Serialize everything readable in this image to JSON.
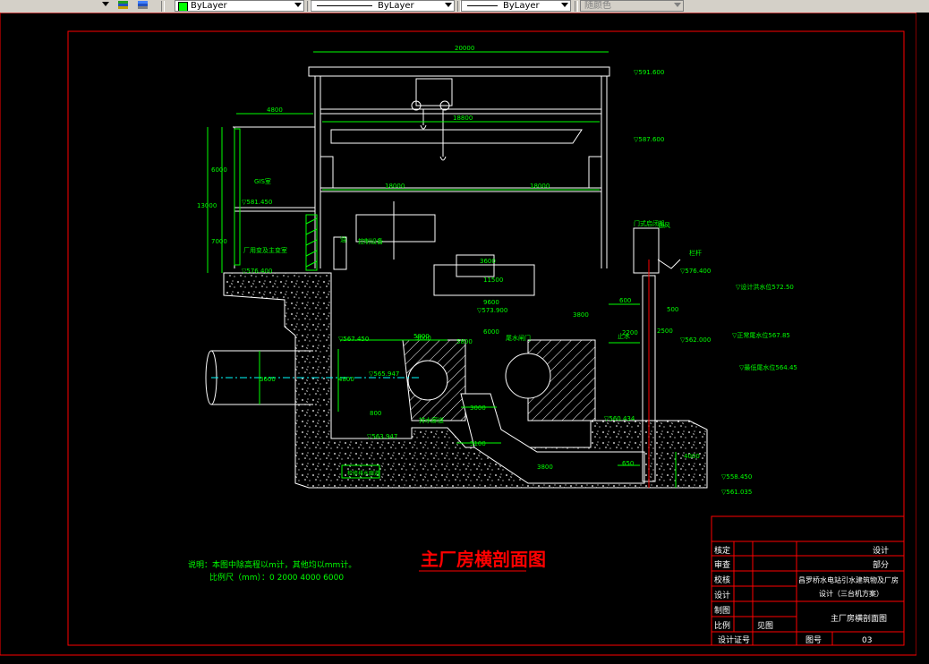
{
  "toolbar": {
    "layer_prop_1": "ByLayer",
    "layer_prop_2": "ByLayer",
    "layer_prop_3": "ByLayer",
    "color_select": "随颜色",
    "color_swatch": "#00ff00",
    "icons": [
      "layer-state-icon",
      "layer-previous-icon"
    ]
  },
  "drawing": {
    "title": "主厂房横剖面图",
    "note_line1": "说明：本图中除高程以m计，其他均以mm计。",
    "note_line2": "比例尺（mm）：0   2000  4000  6000",
    "dims": {
      "top_width": "20000",
      "crane_span": "18800",
      "gen_hall_left": "4800",
      "left_width": "18000",
      "right_width": "18000",
      "height_6000": "6000",
      "height_7000": "7000",
      "height_13000": "13000",
      "d_3600": "3600",
      "d_11500": "11500",
      "d_9600": "9600",
      "d_6000": "6000",
      "d_5800": "5800",
      "d_5800b": "5800",
      "d_3600b": "3600",
      "d_4800": "4800",
      "d_5800c": "5800",
      "d_600": "600",
      "d_500": "500",
      "d_3800": "3800",
      "d_2200": "2200",
      "d_5100": "5100",
      "d_3000": "3000",
      "d_800": "800",
      "d_3800b": "3800",
      "d_650": "650",
      "d_4000": "4000",
      "d_2500": "2500",
      "d_3000b": "3000"
    },
    "elevations": {
      "e1": "▽591.600",
      "e2": "▽587.600",
      "e3": "▽581.450",
      "e4": "▽576.400",
      "e5": "▽576.400",
      "e6": "▽573.900",
      "e7": "▽567.450",
      "e8": "▽565.947",
      "e9": "▽563.947",
      "e10": "▽560.434",
      "e11": "▽562.000",
      "e12": "▽558.450",
      "e13": "▽561.035"
    },
    "labels": {
      "gis_room": "GIS室",
      "cable_layer": "厂用变及主变室",
      "control": "控制设备",
      "gantry": "门式启闭机",
      "tailgate": "尾水闸门",
      "flood_level1": "▽设计洪水位572.50",
      "flood_level2": "▽正常尾水位567.85",
      "flood_level3": "▽最低尾水位564.45",
      "drain_gallery": "排水廊道",
      "oil_tank": "油",
      "water_stop": "止水",
      "platform": "通风",
      "gallery": "检修排水廊道",
      "railing": "栏杆"
    }
  },
  "title_block": {
    "rows": [
      {
        "role": "核定",
        "name": ""
      },
      {
        "role": "审查",
        "name": ""
      },
      {
        "role": "校核",
        "name": ""
      },
      {
        "role": "设计",
        "name": ""
      },
      {
        "role": "制图",
        "name": ""
      },
      {
        "role": "比例",
        "name": "见图"
      },
      {
        "role": "设计证号",
        "name": ""
      }
    ],
    "right_design": "设计",
    "right_part": "部分",
    "project_line1": "昌罗桥水电站引水建筑物及厂房",
    "project_line2": "设计（三台机方案）",
    "drawing_name": "主厂房横剖面图",
    "drawing_no_label": "图号",
    "drawing_no": "03"
  }
}
